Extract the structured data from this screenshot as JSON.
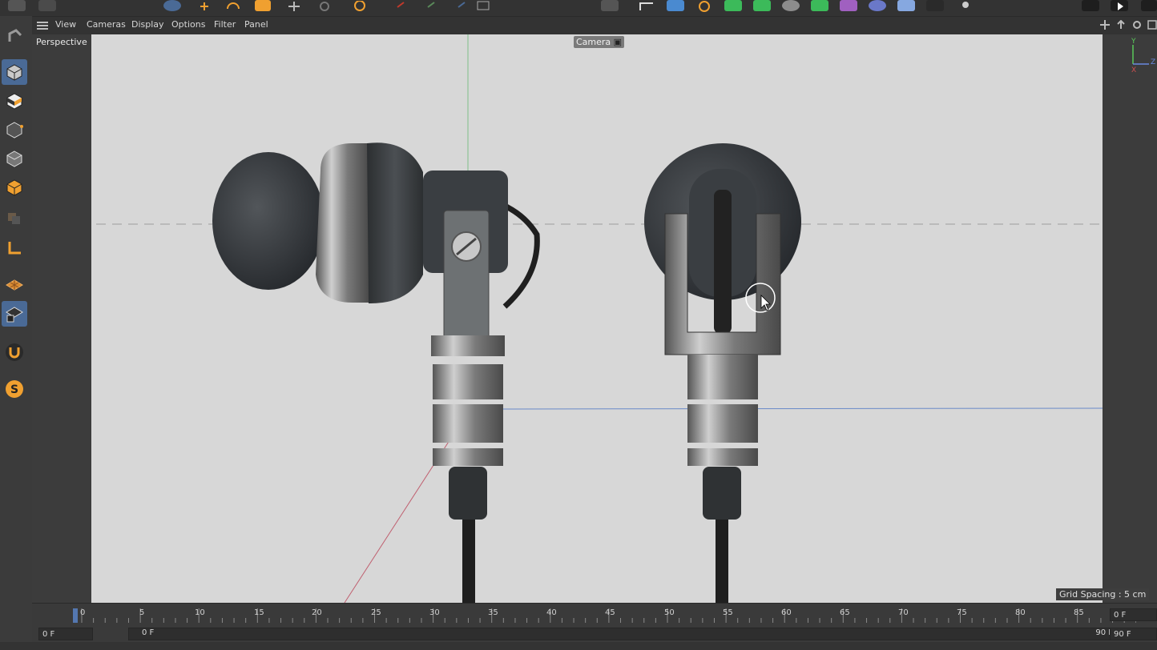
{
  "app": {
    "name": "Cinema 4D"
  },
  "viewport_menu": {
    "items": [
      "View",
      "Cameras",
      "Display",
      "Options",
      "Filter",
      "Panel"
    ]
  },
  "viewport": {
    "label": "Perspective",
    "camera_label": "Camera",
    "grid_spacing": "Grid Spacing : 5 cm",
    "axis": {
      "y": "Y",
      "z": "Z",
      "x": "X"
    }
  },
  "timeline": {
    "ticks": [
      "0",
      "5",
      "10",
      "15",
      "20",
      "25",
      "30",
      "35",
      "40",
      "45",
      "50",
      "55",
      "60",
      "65",
      "70",
      "75",
      "80",
      "85",
      "90"
    ],
    "current_frame": "0 F",
    "start_field": "0 F",
    "slider_start": "0 F",
    "slider_end": "90 F",
    "end_field": "90 F"
  },
  "left_tools": [
    "cube-object-icon",
    "checker-texture-icon",
    "model-edit-icon",
    "polygon-mode-icon",
    "object-mode-icon",
    "layer-icon",
    "axis-tool-icon",
    "workplane-icon",
    "locked-workplane-icon",
    "magnet-icon",
    "sculpt-icon"
  ],
  "colors": {
    "accent": "#4a6a96",
    "viewport_bg": "#d7d7d7",
    "panel_bg": "#3a3a3a",
    "orange": "#f0a030"
  }
}
